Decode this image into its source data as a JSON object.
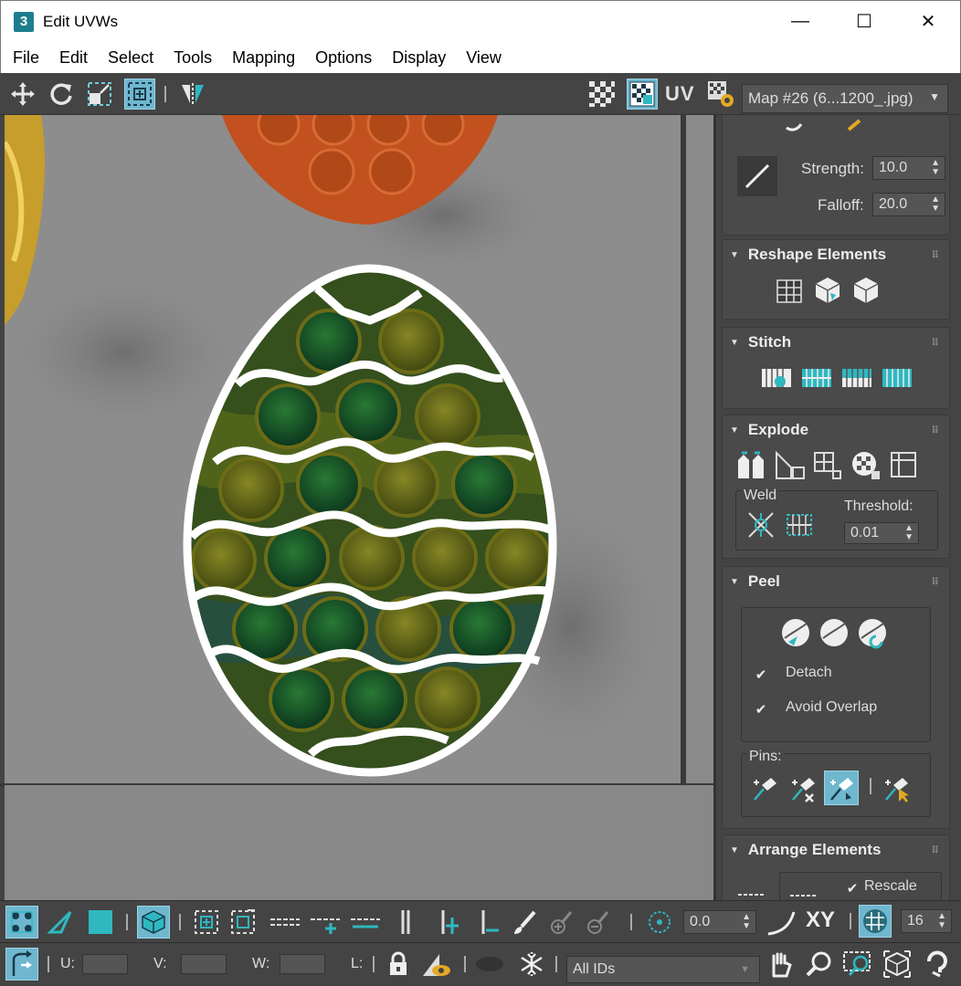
{
  "window": {
    "title": "Edit UVWs",
    "app_icon": "3",
    "controls": {
      "minimize": "—",
      "maximize": "☐",
      "close": "✕"
    }
  },
  "menu": [
    "File",
    "Edit",
    "Select",
    "Tools",
    "Mapping",
    "Options",
    "Display",
    "View"
  ],
  "top_toolbar": {
    "uv_label": "UV",
    "map_select": "Map #26 (6...1200_.jpg)"
  },
  "panel": {
    "soft_select": {
      "strength_label": "Strength:",
      "strength_value": "10.0",
      "falloff_label": "Falloff:",
      "falloff_value": "20.0"
    },
    "reshape": {
      "title": "Reshape Elements"
    },
    "stitch": {
      "title": "Stitch"
    },
    "explode": {
      "title": "Explode",
      "weld_label": "Weld",
      "threshold_label": "Threshold:",
      "threshold_value": "0.01"
    },
    "peel": {
      "title": "Peel",
      "detach_label": "Detach",
      "avoid_overlap_label": "Avoid Overlap",
      "pins_label": "Pins:"
    },
    "arrange": {
      "title": "Arrange Elements",
      "rescale_label": "Rescale"
    }
  },
  "bottom_toolbar": {
    "angle_value": "0.0",
    "xy_label": "XY",
    "grid_value": "16",
    "u_label": "U:",
    "v_label": "V:",
    "w_label": "W:",
    "l_label": "L:",
    "ids_select": "All IDs"
  },
  "colors": {
    "accent": "#6fb7cf",
    "teal": "#2fb8c0",
    "panel_bg": "#444444"
  }
}
